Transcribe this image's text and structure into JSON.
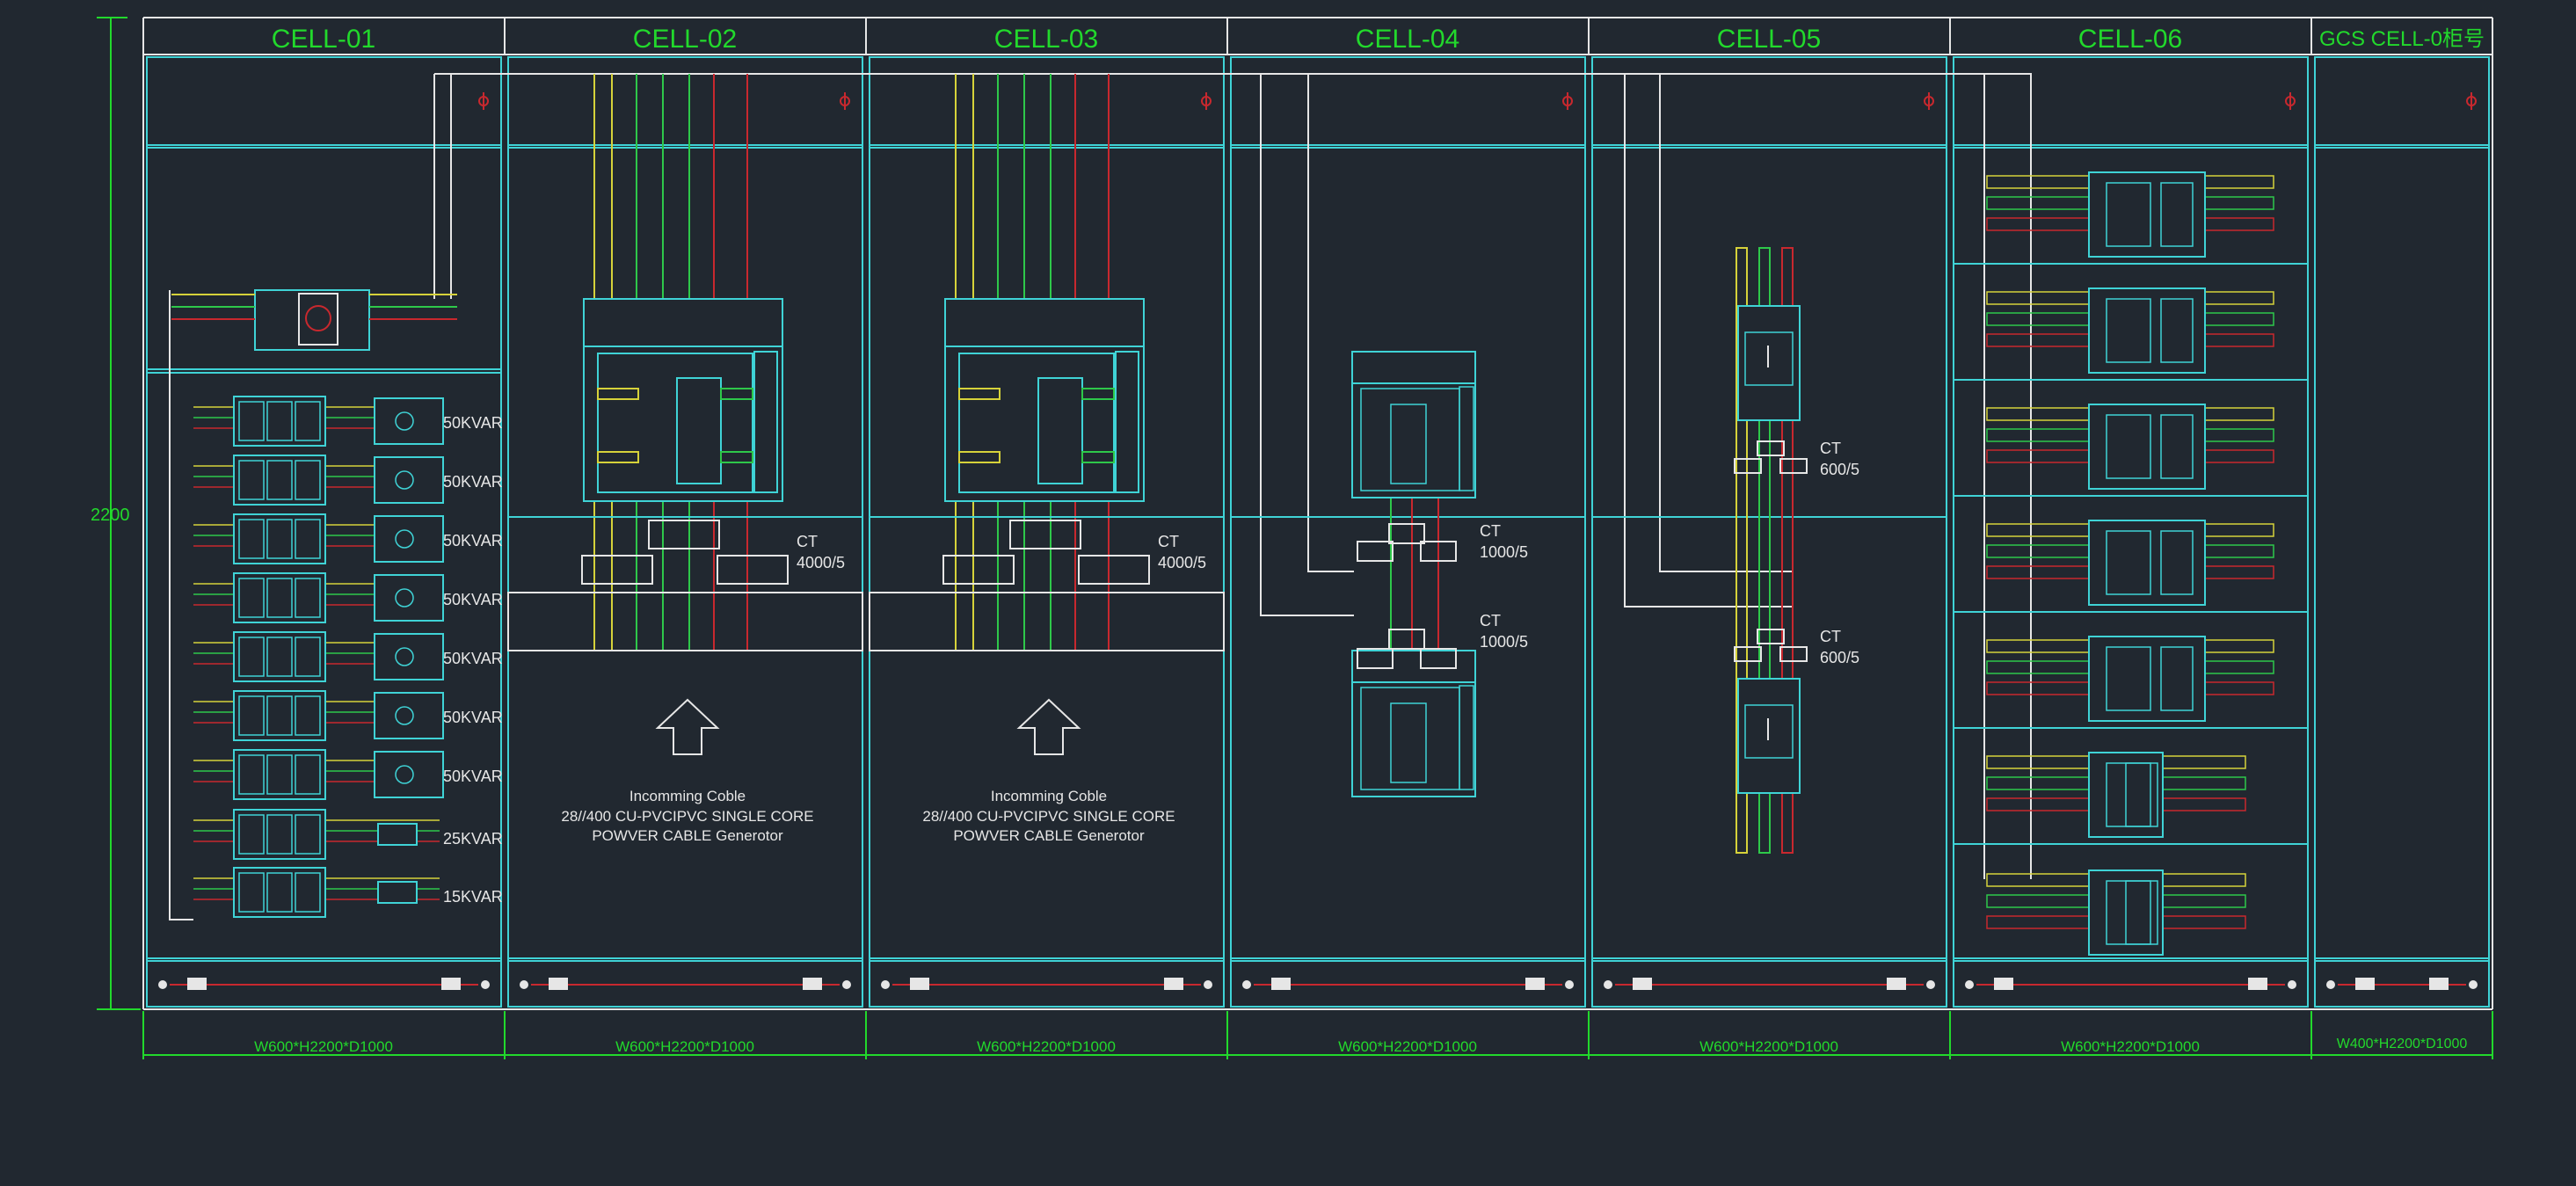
{
  "drawing": {
    "height_dimension": "2200",
    "cells": [
      {
        "title": "CELL-01",
        "size_label": "W600*H2200*D1000"
      },
      {
        "title": "CELL-02",
        "size_label": "W600*H2200*D1000"
      },
      {
        "title": "CELL-03",
        "size_label": "W600*H2200*D1000"
      },
      {
        "title": "CELL-04",
        "size_label": "W600*H2200*D1000"
      },
      {
        "title": "CELL-05",
        "size_label": "W600*H2200*D1000"
      },
      {
        "title": "CELL-06",
        "size_label": "W600*H2200*D1000"
      },
      {
        "title": "GCS CELL-0柜号",
        "size_label": "W400*H2200*D1000"
      }
    ],
    "capacitor_labels": [
      "50KVAR",
      "50KVAR",
      "50KVAR",
      "50KVAR",
      "50KVAR",
      "50KVAR",
      "50KVAR",
      "25KVAR",
      "15KVAR"
    ],
    "ct_labels": {
      "cell02": [
        "CT",
        "4000/5"
      ],
      "cell03": [
        "CT",
        "4000/5"
      ],
      "cell04_upper": [
        "CT",
        "1000/5"
      ],
      "cell04_lower": [
        "CT",
        "1000/5"
      ],
      "cell05_upper": [
        "CT",
        "600/5"
      ],
      "cell05_lower": [
        "CT",
        "600/5"
      ]
    },
    "incoming_cable": {
      "cell02": [
        "Incomming Coble",
        "28//400 CU-PVCIPVC SINGLE CORE",
        "POWVER CABLE Generotor"
      ],
      "cell03": [
        "Incomming Coble",
        "28//400 CU-PVCIPVC SINGLE CORE",
        "POWVER CABLE Generotor"
      ]
    },
    "colors": {
      "background": "#212830",
      "frame": "#3fd3d6",
      "dimension": "#22d92c",
      "phase_yellow": "#d6d23a",
      "phase_green": "#2ec84a",
      "phase_red": "#c8282e",
      "white": "#e6e6e6"
    }
  }
}
